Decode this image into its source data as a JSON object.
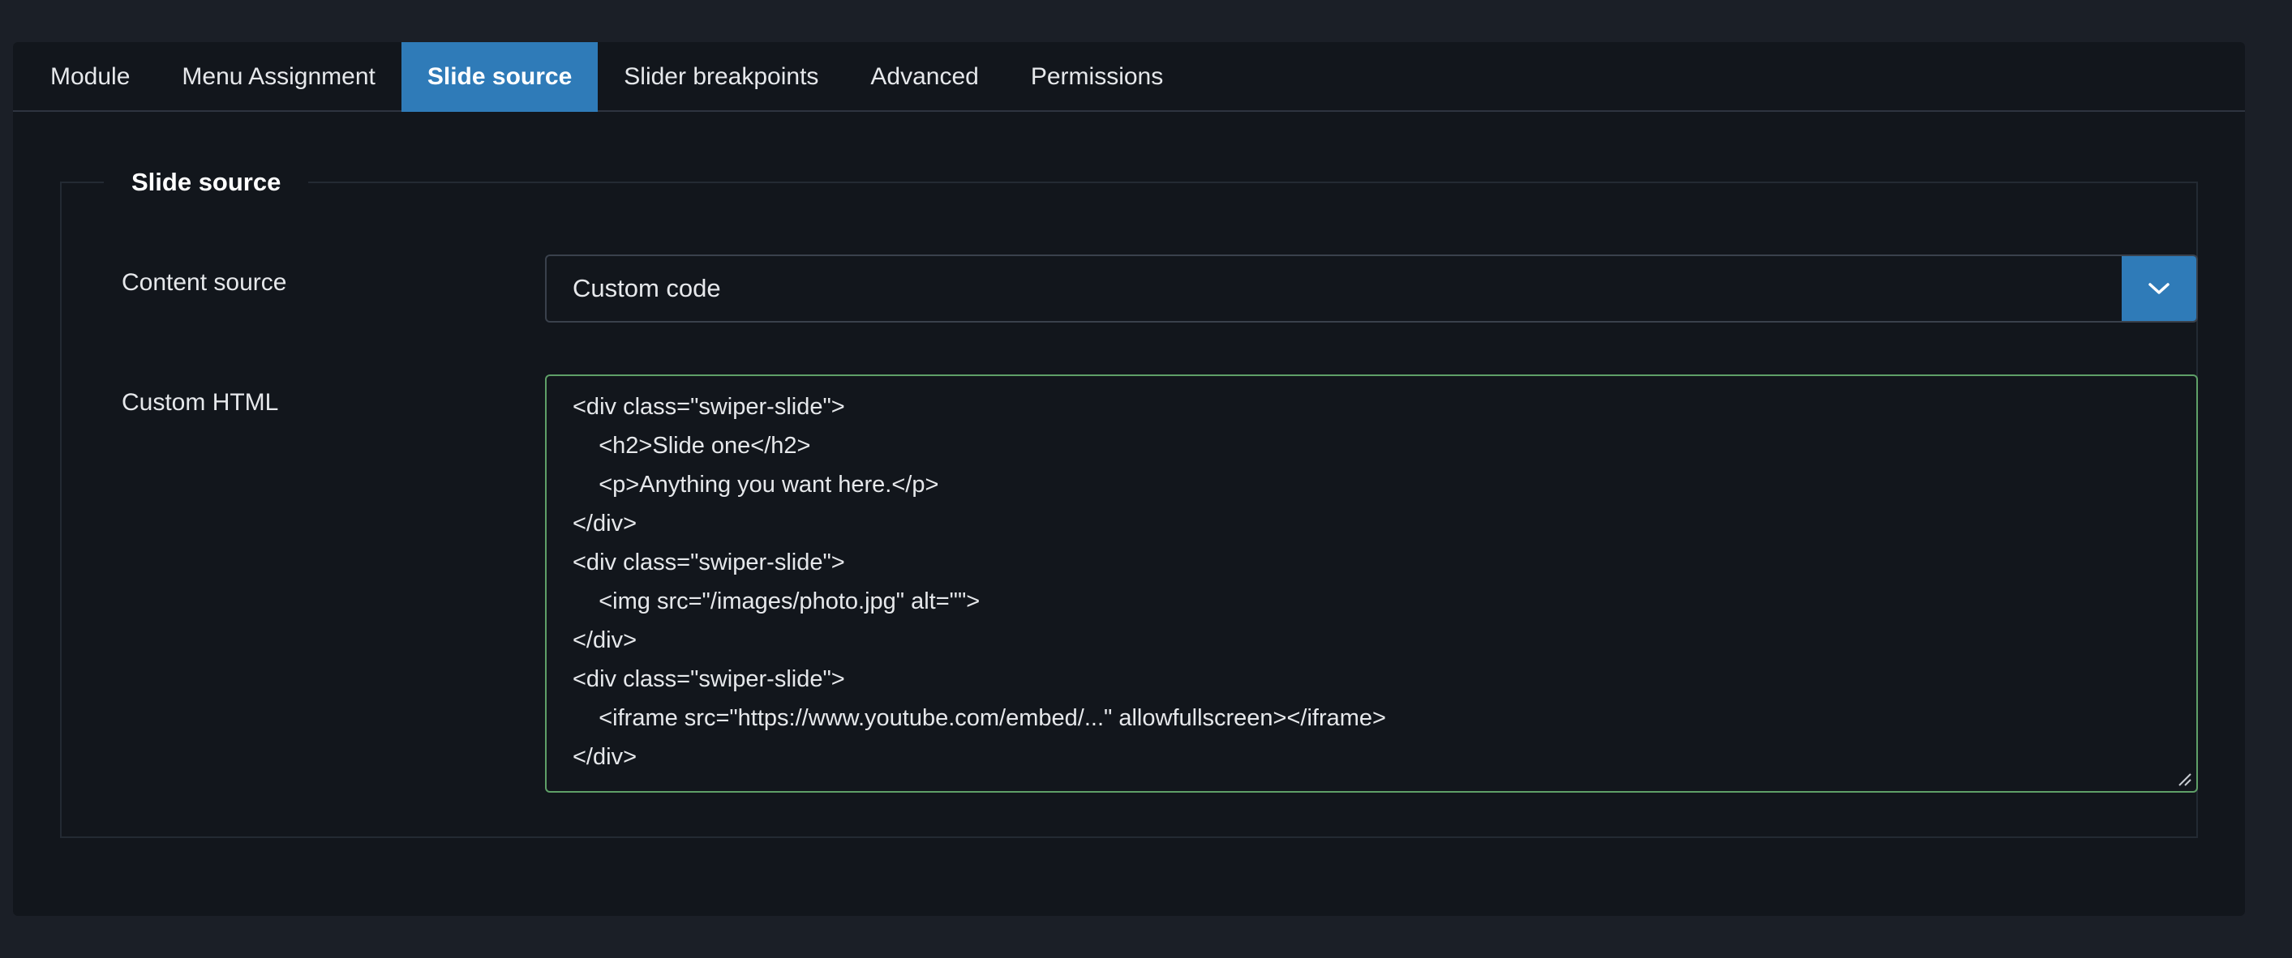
{
  "tabs": [
    {
      "label": "Module",
      "active": false
    },
    {
      "label": "Menu Assignment",
      "active": false
    },
    {
      "label": "Slide source",
      "active": true
    },
    {
      "label": "Slider breakpoints",
      "active": false
    },
    {
      "label": "Advanced",
      "active": false
    },
    {
      "label": "Permissions",
      "active": false
    }
  ],
  "fieldset": {
    "legend": "Slide source",
    "content_source": {
      "label": "Content source",
      "value": "Custom code"
    },
    "custom_html": {
      "label": "Custom HTML",
      "lines": [
        "<div class=\"swiper-slide\">",
        "    <h2>Slide one</h2>",
        "    <p>Anything you want here.</p>",
        "</div>",
        "<div class=\"swiper-slide\">",
        "    <img src=\"/images/photo.jpg\" alt=\"\">",
        "</div>",
        "<div class=\"swiper-slide\">",
        "    <iframe src=\"https://www.youtube.com/embed/...\" allowfullscreen></iframe>",
        "</div>"
      ]
    }
  },
  "colors": {
    "page_bg": "#1b1f27",
    "card_bg": "#12161c",
    "accent": "#2f7bb8",
    "textarea_border": "#5fa068"
  },
  "icons": {
    "select_toggle": "chevron-down-icon",
    "textarea_resize": "resize-handle-icon"
  }
}
